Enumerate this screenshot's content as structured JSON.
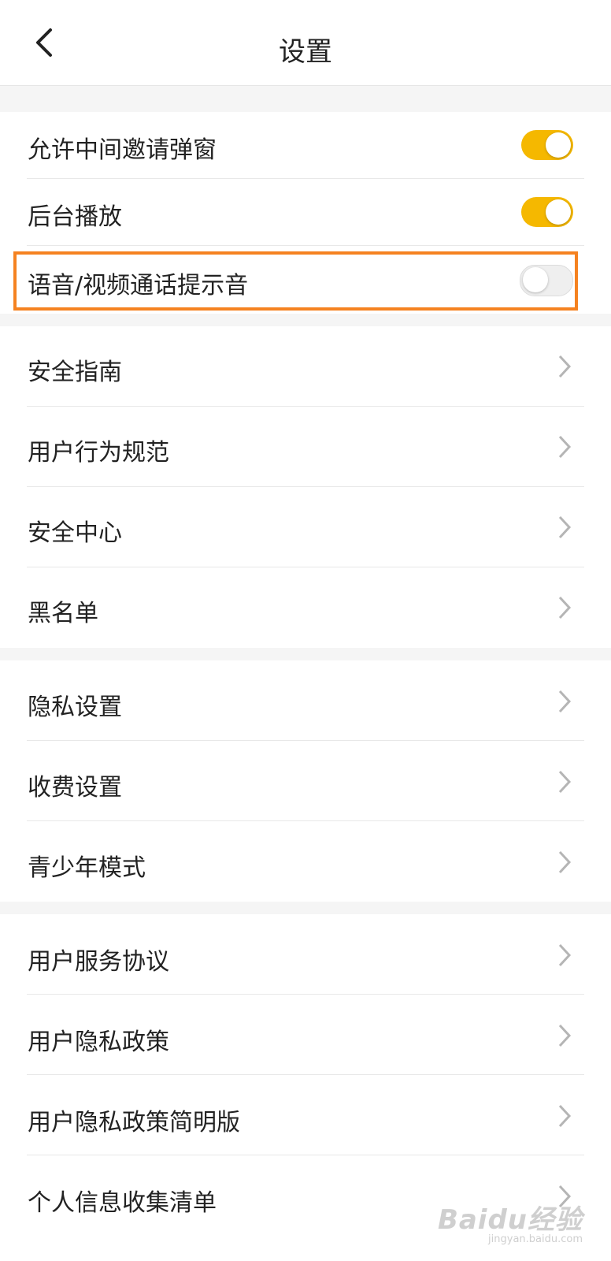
{
  "header": {
    "title": "设置",
    "back_icon": "chevron-left-icon"
  },
  "toggles": [
    {
      "label": "允许中间邀请弹窗",
      "on": true
    },
    {
      "label": "后台播放",
      "on": true
    },
    {
      "label": "语音/视频通话提示音",
      "on": false
    }
  ],
  "section_safety": [
    {
      "label": "安全指南"
    },
    {
      "label": "用户行为规范"
    },
    {
      "label": "安全中心"
    },
    {
      "label": "黑名单"
    }
  ],
  "section_privacy": [
    {
      "label": "隐私设置"
    },
    {
      "label": "收费设置"
    },
    {
      "label": "青少年模式"
    }
  ],
  "section_legal": [
    {
      "label": "用户服务协议"
    },
    {
      "label": "用户隐私政策"
    },
    {
      "label": "用户隐私政策简明版"
    },
    {
      "label": "个人信息收集清单"
    }
  ],
  "watermark": {
    "logo": "Baidu经验",
    "url": "jingyan.baidu.com"
  },
  "colors": {
    "accent": "#f5b800",
    "highlight": "#f58220"
  }
}
